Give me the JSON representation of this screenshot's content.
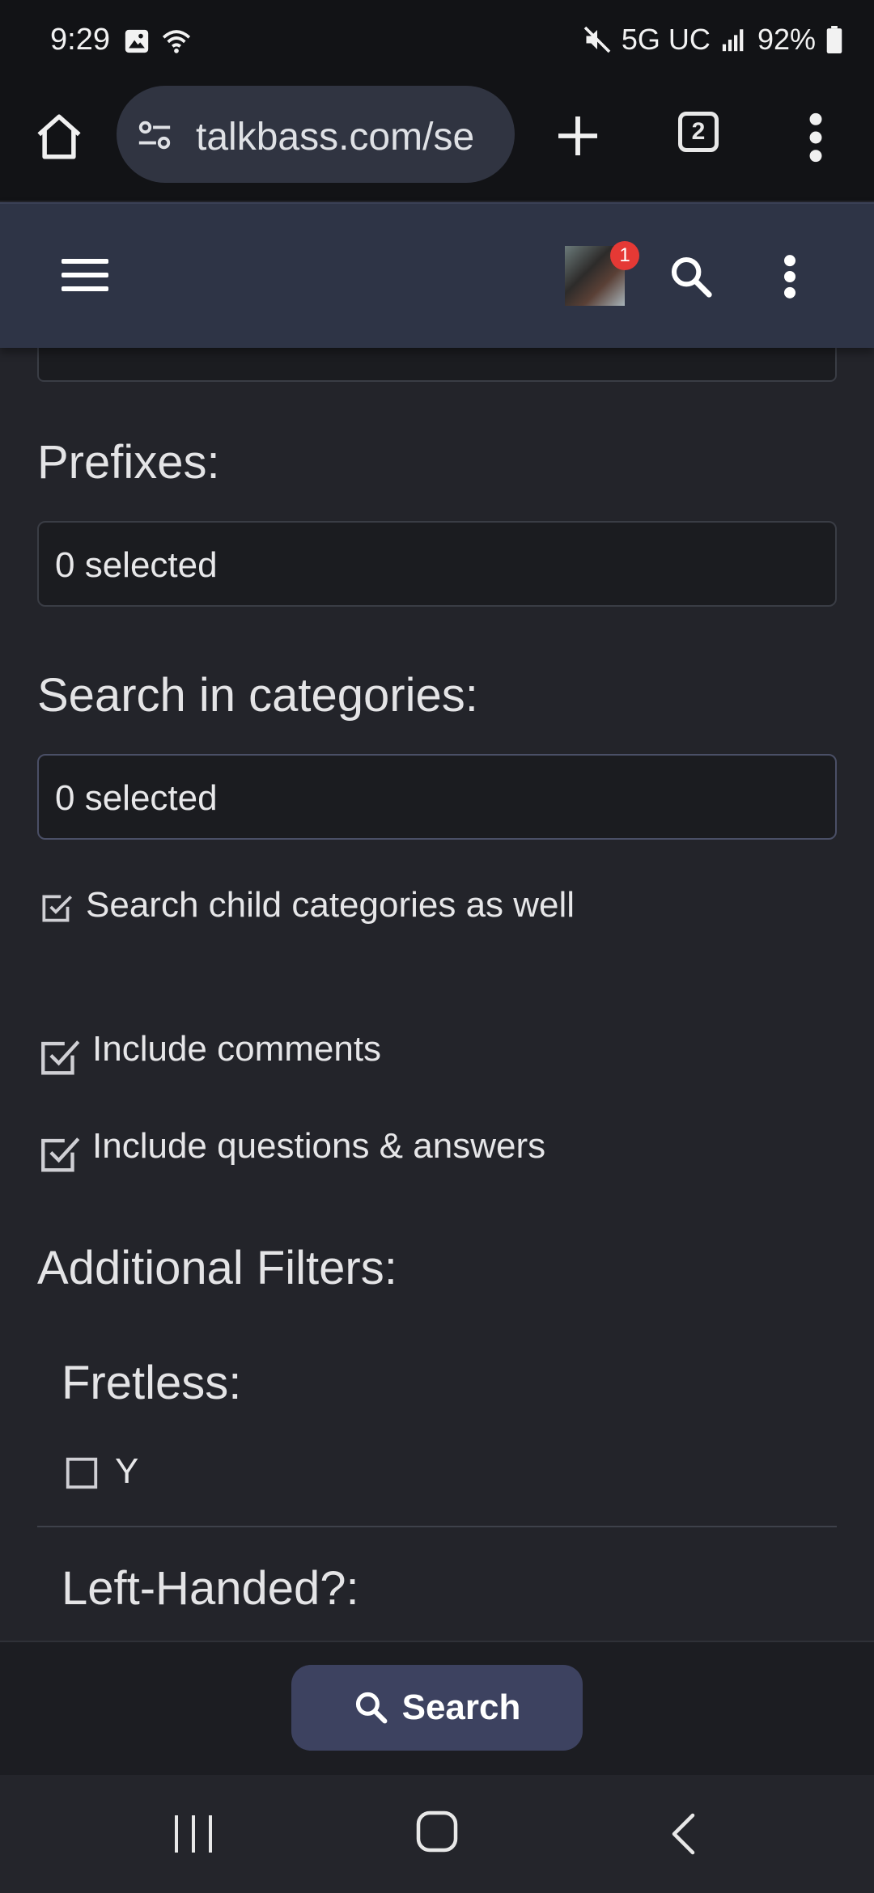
{
  "status_bar": {
    "time": "9:29",
    "network": "5G UC",
    "battery": "92%",
    "icons": [
      "gallery-icon",
      "wifi-icon",
      "mute-icon",
      "signal-icon",
      "battery-icon"
    ]
  },
  "browser": {
    "url": "talkbass.com/se",
    "tab_count": "2",
    "icons": [
      "home-icon",
      "site-settings-icon",
      "new-tab-icon",
      "more-vert-icon"
    ]
  },
  "site_header": {
    "notification_count": "1",
    "icons": [
      "hamburger-menu-icon",
      "avatar",
      "search-icon",
      "more-vert-icon"
    ]
  },
  "form": {
    "prefixes": {
      "label": "Prefixes:",
      "value": "0 selected"
    },
    "categories": {
      "label": "Search in categories:",
      "value": "0 selected"
    },
    "child_categories": {
      "label": "Search child categories as well",
      "checked": true
    },
    "include_comments": {
      "label": "Include comments",
      "checked": true
    },
    "include_qa": {
      "label": "Include questions & answers",
      "checked": true
    },
    "additional_filters": {
      "label": "Additional Filters:",
      "fretless": {
        "label": "Fretless:",
        "option": "Y",
        "checked": false
      },
      "left_handed": {
        "label": "Left-Handed?:"
      }
    }
  },
  "search_button": {
    "label": "Search"
  },
  "colors": {
    "page_bg": "#23242a",
    "header_bg": "#2e3446",
    "field_bg": "#1b1c20",
    "button_bg": "#3d4260",
    "badge": "#e53935"
  }
}
